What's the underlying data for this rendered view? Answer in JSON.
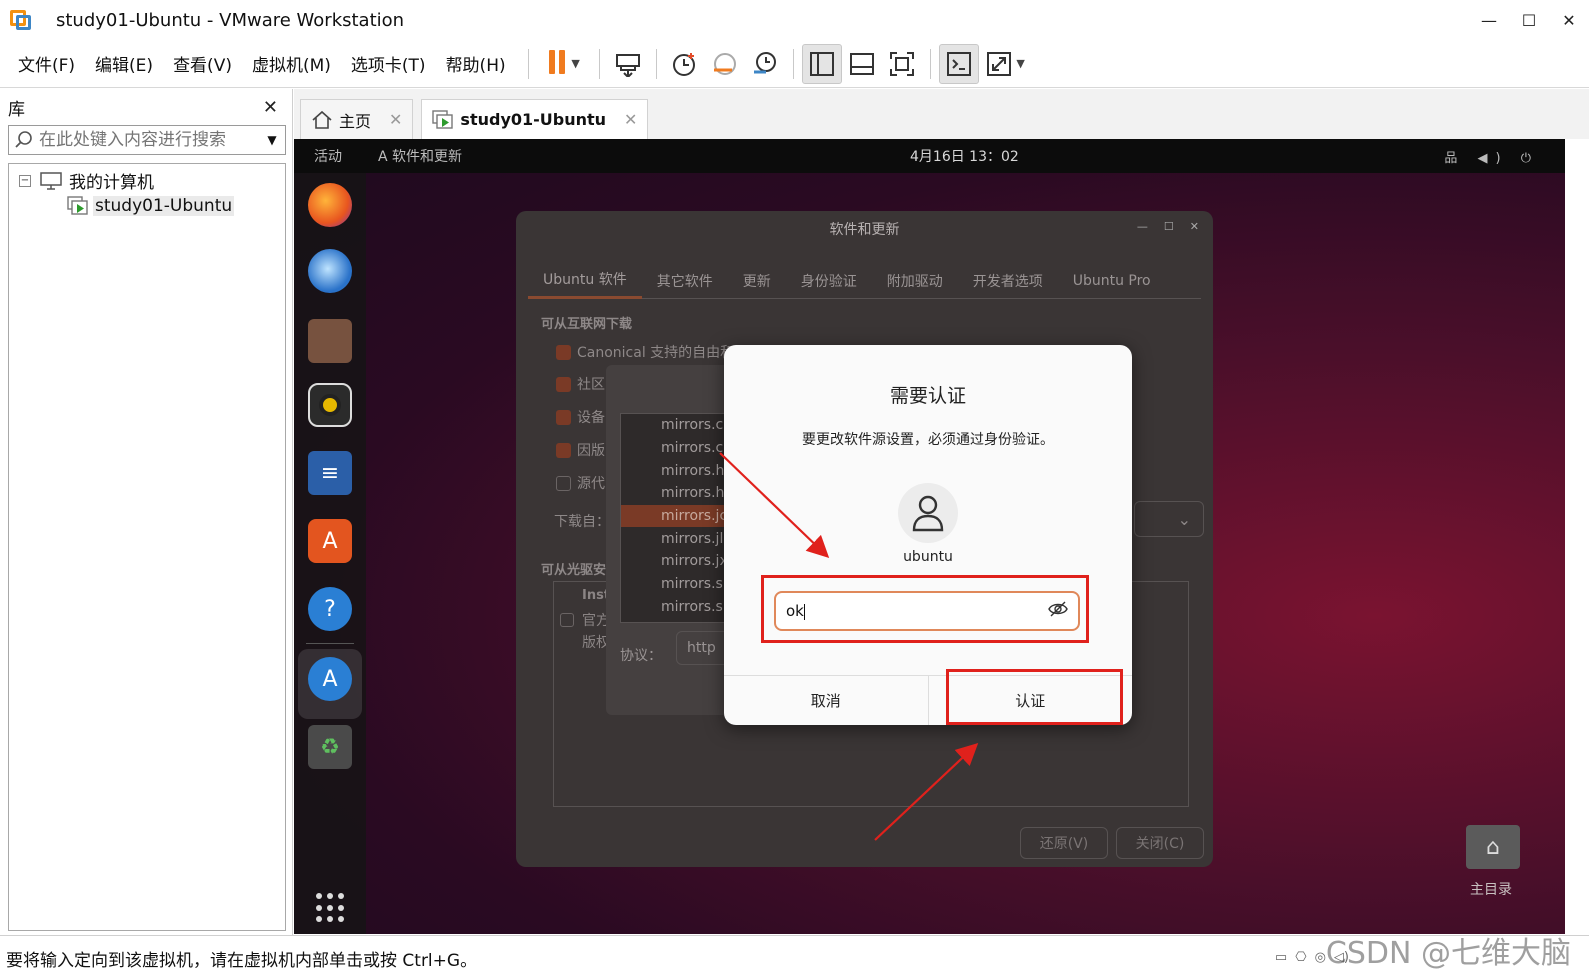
{
  "window": {
    "title": "study01-Ubuntu - VMware Workstation",
    "minimize": "—",
    "maximize": "☐",
    "close": "✕"
  },
  "menu": [
    "文件(F)",
    "编辑(E)",
    "查看(V)",
    "虚拟机(M)",
    "选项卡(T)",
    "帮助(H)"
  ],
  "library": {
    "title": "库",
    "close": "✕",
    "search_placeholder": "在此处键入内容进行搜索",
    "tree_root": "我的计算机",
    "tree_toggle": "−",
    "vm_name": "study01-Ubuntu"
  },
  "tabs": [
    {
      "label": "主页"
    },
    {
      "label": "study01-Ubuntu"
    }
  ],
  "guest": {
    "topbar": {
      "activities": "活动",
      "app_menu": "A 软件和更新",
      "clock": "4月16日  13：02",
      "sys": "品 ◀) ⏻"
    },
    "sw_window": {
      "title": "软件和更新",
      "controls": [
        "—",
        "☐",
        "✕"
      ],
      "tabs": [
        "Ubuntu 软件",
        "其它软件",
        "更新",
        "身份验证",
        "附加驱动",
        "开发者选项",
        "Ubuntu Pro"
      ],
      "section_download": "可从互联网下载",
      "checks": [
        "Canonical 支持的自由和",
        "社区",
        "设备",
        "因版",
        "源代"
      ],
      "download_from": "下载自：",
      "section_cd": "可从光驱安",
      "cd_items": [
        "Inst",
        "官方",
        "版权"
      ],
      "revert": "还原(V)",
      "close": "关闭(C)"
    },
    "mirror_dialog": {
      "mirrors": [
        "mirrors.cn",
        "mirrors.c",
        "mirrors.h",
        "mirrors.h",
        "mirrors.jc",
        "mirrors.jl",
        "mirrors.jx",
        "mirrors.s",
        "mirrors.s"
      ],
      "selected_index": 4,
      "protocol_label": "协议：",
      "protocol_value": "http"
    },
    "auth_dialog": {
      "title": "需要认证",
      "message": "要更改软件源设置，必须通过身份验证。",
      "username": "ubuntu",
      "password_value": "ok",
      "cancel": "取消",
      "confirm": "认证"
    },
    "desktop_home_label": "主目录"
  },
  "statusbar": {
    "message": "要将输入定向到该虚拟机，请在虚拟机内部单击或按 Ctrl+G。"
  },
  "watermark": "CSDN @七维大脑",
  "colors": {
    "annotation_red": "#e0211c",
    "ubuntu_accent": "#e0885a",
    "vmware_orange": "#f07b1f"
  }
}
